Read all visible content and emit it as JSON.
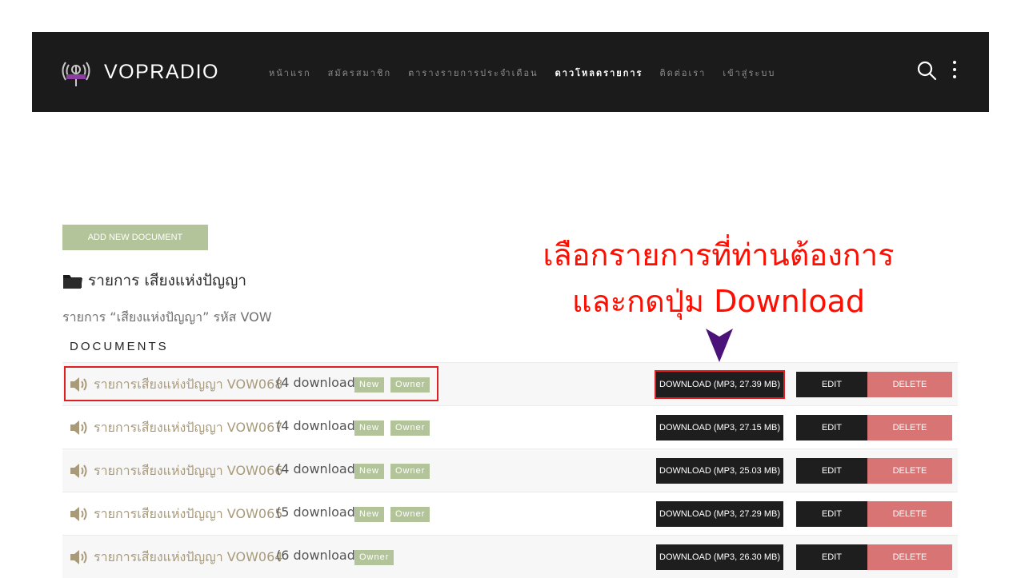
{
  "header": {
    "site_title": "VOPRADIO",
    "nav": [
      {
        "label": "หน้าแรก"
      },
      {
        "label": "สมัครสมาชิก"
      },
      {
        "label": "ตารางรายการประจำเดือน"
      },
      {
        "label": "ดาวโหลดรายการ"
      },
      {
        "label": "ติดต่อเรา"
      },
      {
        "label": "เข้าสู่ระบบ"
      }
    ],
    "active_nav": "ดาวโหลดรายการ",
    "icons": [
      "radio-tower-icon",
      "search-icon",
      "more-vertical-icon"
    ]
  },
  "toolbar": {
    "add_label": "ADD NEW DOCUMENT"
  },
  "category": {
    "title": "รายการ เสียงแห่งปัญญา",
    "description": "รายการ “เสียงแห่งปัญญา” รหัส VOW",
    "icon": "folder-icon"
  },
  "annotation": {
    "line1": "เลือกรายการที่ท่านต้องการ",
    "line2": "และกดปุ่ม Download",
    "color": "#ff0d00"
  },
  "documents": {
    "heading": "DOCUMENTS",
    "items": [
      {
        "title": "รายการเสียงแห่งปัญญา VOW068",
        "count": "(4 download)",
        "badges": [
          "New",
          "Owner"
        ],
        "download": "DOWNLOAD (MP3, 27.39 MB)",
        "edit": "EDIT",
        "delete": "DELETE"
      },
      {
        "title": "รายการเสียงแห่งปัญญา VOW067",
        "count": "(4 download)",
        "badges": [
          "New",
          "Owner"
        ],
        "download": "DOWNLOAD (MP3, 27.15 MB)",
        "edit": "EDIT",
        "delete": "DELETE"
      },
      {
        "title": "รายการเสียงแห่งปัญญา VOW066",
        "count": "(4 download)",
        "badges": [
          "New",
          "Owner"
        ],
        "download": "DOWNLOAD (MP3, 25.03 MB)",
        "edit": "EDIT",
        "delete": "DELETE"
      },
      {
        "title": "รายการเสียงแห่งปัญญา VOW065",
        "count": "(5 download)",
        "badges": [
          "New",
          "Owner"
        ],
        "download": "DOWNLOAD (MP3, 27.29 MB)",
        "edit": "EDIT",
        "delete": "DELETE"
      },
      {
        "title": "รายการเสียงแห่งปัญญา VOW064",
        "count": "(6 download)",
        "badges": [
          "Owner"
        ],
        "download": "DOWNLOAD (MP3, 26.30 MB)",
        "edit": "EDIT",
        "delete": "DELETE"
      }
    ]
  },
  "colors": {
    "header_bg": "#1b1b1b",
    "accent_green": "#b3c49a",
    "delete_red": "#d87474",
    "link_tan": "#a99a7a",
    "arrow_purple": "#4b137a"
  }
}
